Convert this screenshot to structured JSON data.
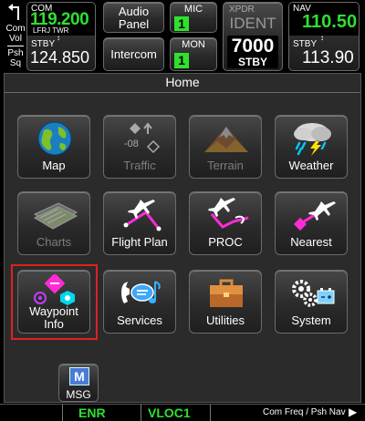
{
  "top": {
    "com": {
      "label": "COM",
      "active": "119.200",
      "station": "LFRJ TWR",
      "stby_label": "STBY",
      "standby": "124.850"
    },
    "vol": {
      "line1": "Com",
      "line2": "Vol",
      "line3": "Psh",
      "line4": "Sq"
    },
    "audio": {
      "label_line1": "Audio",
      "label_line2": "Panel"
    },
    "intercom": {
      "label": "Intercom"
    },
    "mic": {
      "label": "MIC",
      "value": "1"
    },
    "mon": {
      "label": "MON",
      "value": "1"
    },
    "xpdr": {
      "label": "XPDR",
      "ident": "IDENT",
      "code": "7000",
      "mode": "STBY"
    },
    "nav": {
      "label": "NAV",
      "active": "110.50",
      "stby_label": "STBY",
      "standby": "113.90"
    }
  },
  "home_title": "Home",
  "grid": [
    {
      "label": "Map",
      "icon": "globe-icon",
      "enabled": true
    },
    {
      "label": "Traffic",
      "icon": "traffic-icon",
      "enabled": false,
      "overlay": "-08"
    },
    {
      "label": "Terrain",
      "icon": "terrain-icon",
      "enabled": false
    },
    {
      "label": "Weather",
      "icon": "storm-cloud-icon",
      "enabled": true
    },
    {
      "label": "Charts",
      "icon": "charts-icon",
      "enabled": false
    },
    {
      "label": "Flight Plan",
      "icon": "flight-plan-icon",
      "enabled": true
    },
    {
      "label": "PROC",
      "icon": "procedure-icon",
      "enabled": true
    },
    {
      "label": "Nearest",
      "icon": "nearest-icon",
      "enabled": true
    },
    {
      "label_line1": "Waypoint",
      "label_line2": "Info",
      "icon": "waypoint-info-icon",
      "enabled": true,
      "highlighted": true
    },
    {
      "label": "Services",
      "icon": "services-icon",
      "enabled": true
    },
    {
      "label": "Utilities",
      "icon": "toolbox-icon",
      "enabled": true
    },
    {
      "label": "System",
      "icon": "gears-battery-icon",
      "enabled": true
    }
  ],
  "msg": {
    "label": "MSG",
    "icon_letter": "M"
  },
  "status": {
    "mode1": "ENR",
    "mode2": "VLOC1",
    "hint": "Com Freq / Psh Nav"
  },
  "colors": {
    "green": "#2fe02f",
    "cyan": "#00e5ff",
    "magenta": "#ff2bd6",
    "highlight": "#e02020"
  }
}
